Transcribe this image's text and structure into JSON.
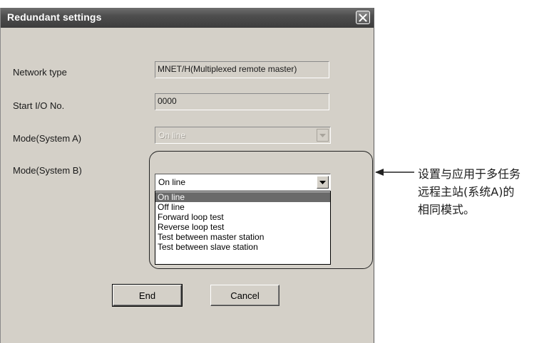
{
  "dialog": {
    "title": "Redundant settings",
    "fields": {
      "network_type": {
        "label": "Network type",
        "value": "MNET/H(Multiplexed remote master)"
      },
      "start_io": {
        "label": "Start I/O No.",
        "value": "0000"
      },
      "mode_a": {
        "label": "Mode(System A)",
        "value": "On line"
      },
      "mode_b": {
        "label": "Mode(System B)",
        "value": "On line"
      }
    },
    "dropdown_options": [
      "On line",
      "Off line",
      "Forward loop test",
      "Reverse loop test",
      "Test between master station",
      "Test between slave station"
    ],
    "buttons": {
      "end": "End",
      "cancel": "Cancel"
    }
  },
  "callout": {
    "lines": [
      "设置与应用于多任务",
      "远程主站(系统A)的",
      "相同模式。"
    ]
  },
  "icons": {
    "close": "close-icon",
    "dropdown_arrow": "chevron-down-icon",
    "callout_arrow": "arrow-left-icon"
  },
  "colors": {
    "titlebar": "#4e4e4e",
    "dialog_bg": "#d4d0c8",
    "selection": "#6a6a6a"
  }
}
